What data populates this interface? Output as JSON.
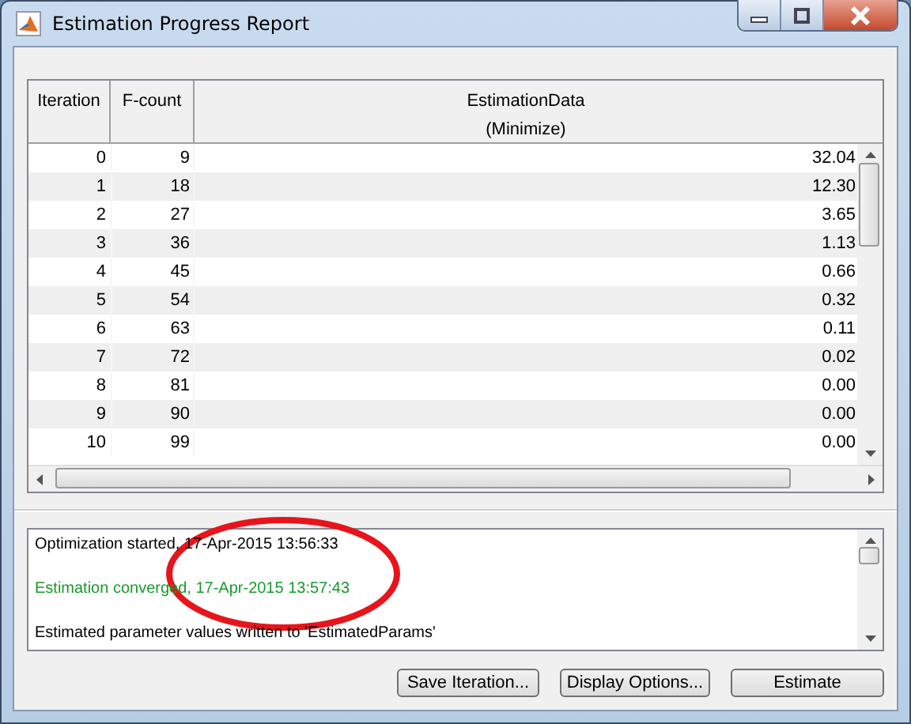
{
  "window": {
    "title": "Estimation Progress Report"
  },
  "table": {
    "columns": [
      {
        "lines": [
          "Iteration"
        ]
      },
      {
        "lines": [
          "F-count"
        ]
      },
      {
        "lines": [
          "EstimationData",
          "(Minimize)"
        ]
      }
    ],
    "rows": [
      [
        "0",
        "9",
        "32.04"
      ],
      [
        "1",
        "18",
        "12.30"
      ],
      [
        "2",
        "27",
        "3.65"
      ],
      [
        "3",
        "36",
        "1.13"
      ],
      [
        "4",
        "45",
        "0.66"
      ],
      [
        "5",
        "54",
        "0.32"
      ],
      [
        "6",
        "63",
        "0.11"
      ],
      [
        "7",
        "72",
        "0.02"
      ],
      [
        "8",
        "81",
        "0.00"
      ],
      [
        "9",
        "90",
        "0.00"
      ],
      [
        "10",
        "99",
        "0.00"
      ]
    ]
  },
  "log": [
    {
      "kind": "info",
      "text": "Optimization started, 17-Apr-2015 13:56:33"
    },
    {
      "kind": "blank"
    },
    {
      "kind": "success",
      "text": "Estimation converged, 17-Apr-2015 13:57:43"
    },
    {
      "kind": "blank"
    },
    {
      "kind": "info",
      "text": "Estimated parameter values written to 'EstimatedParams'"
    }
  ],
  "buttons": [
    "Save Iteration...",
    "Display Options...",
    "Estimate"
  ]
}
